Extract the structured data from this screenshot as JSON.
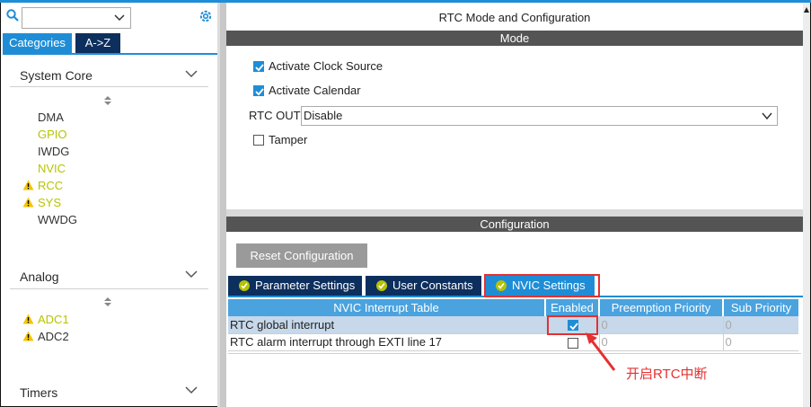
{
  "sidebar": {
    "search": {
      "value": "",
      "placeholder": ""
    },
    "tabs": {
      "categories": "Categories",
      "az": "A->Z"
    },
    "sections": [
      {
        "title": "System Core"
      },
      {
        "title": "Analog"
      },
      {
        "title": "Timers"
      }
    ],
    "system_core_items": [
      {
        "label": "DMA",
        "status": "plain"
      },
      {
        "label": "GPIO",
        "status": "green"
      },
      {
        "label": "IWDG",
        "status": "plain"
      },
      {
        "label": "NVIC",
        "status": "green"
      },
      {
        "label": "RCC",
        "status": "warning"
      },
      {
        "label": "SYS",
        "status": "warning"
      },
      {
        "label": "WWDG",
        "status": "plain"
      }
    ],
    "analog_items": [
      {
        "label": "ADC1",
        "status": "warning"
      },
      {
        "label": "ADC2",
        "status": "warning"
      }
    ]
  },
  "main": {
    "title": "RTC Mode and Configuration",
    "mode_bar": "Mode",
    "mode": {
      "activate_clock_source": {
        "label": "Activate Clock Source",
        "checked": true
      },
      "activate_calendar": {
        "label": "Activate Calendar",
        "checked": true
      },
      "rtc_out": {
        "label": "RTC OUT",
        "value": "Disable"
      },
      "tamper": {
        "label": "Tamper",
        "checked": false
      }
    },
    "config_bar": "Configuration",
    "reset_button": "Reset Configuration",
    "subtabs": [
      "Parameter Settings",
      "User Constants",
      "NVIC Settings"
    ],
    "active_subtab": "NVIC Settings",
    "nvic_table": {
      "headers": [
        "NVIC Interrupt Table",
        "Enabled",
        "Preemption Priority",
        "Sub Priority"
      ],
      "rows": [
        {
          "name": "RTC global interrupt",
          "enabled": true,
          "preemption": "0",
          "sub": "0"
        },
        {
          "name": "RTC alarm interrupt through EXTI line 17",
          "enabled": false,
          "preemption": "0",
          "sub": "0"
        }
      ]
    },
    "annotation": "开启RTC中断"
  },
  "colors": {
    "accent": "#1f8dd6",
    "tab_dark": "#0d2f5e",
    "bar_gray": "#545454",
    "highlight_red": "#e53030",
    "green_text": "#b7c300",
    "warning": "#f5c400"
  }
}
